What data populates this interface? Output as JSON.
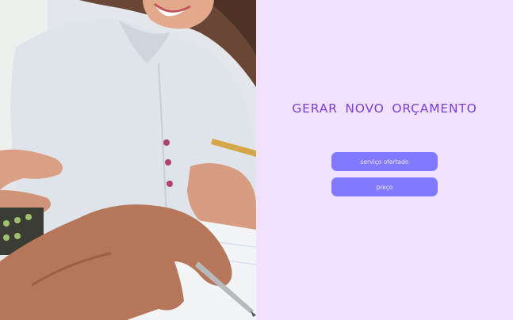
{
  "form": {
    "title": "GERAR NOVO ORÇAMENTO",
    "service_label": "serviço ofertado",
    "price_label": "preço"
  },
  "colors": {
    "form_background": "#efe1ff",
    "title": "#7b3fd6",
    "button": "#8179ff",
    "button_text": "#efe8ff"
  },
  "image": {
    "description_icon": "photo-woman-writing"
  }
}
